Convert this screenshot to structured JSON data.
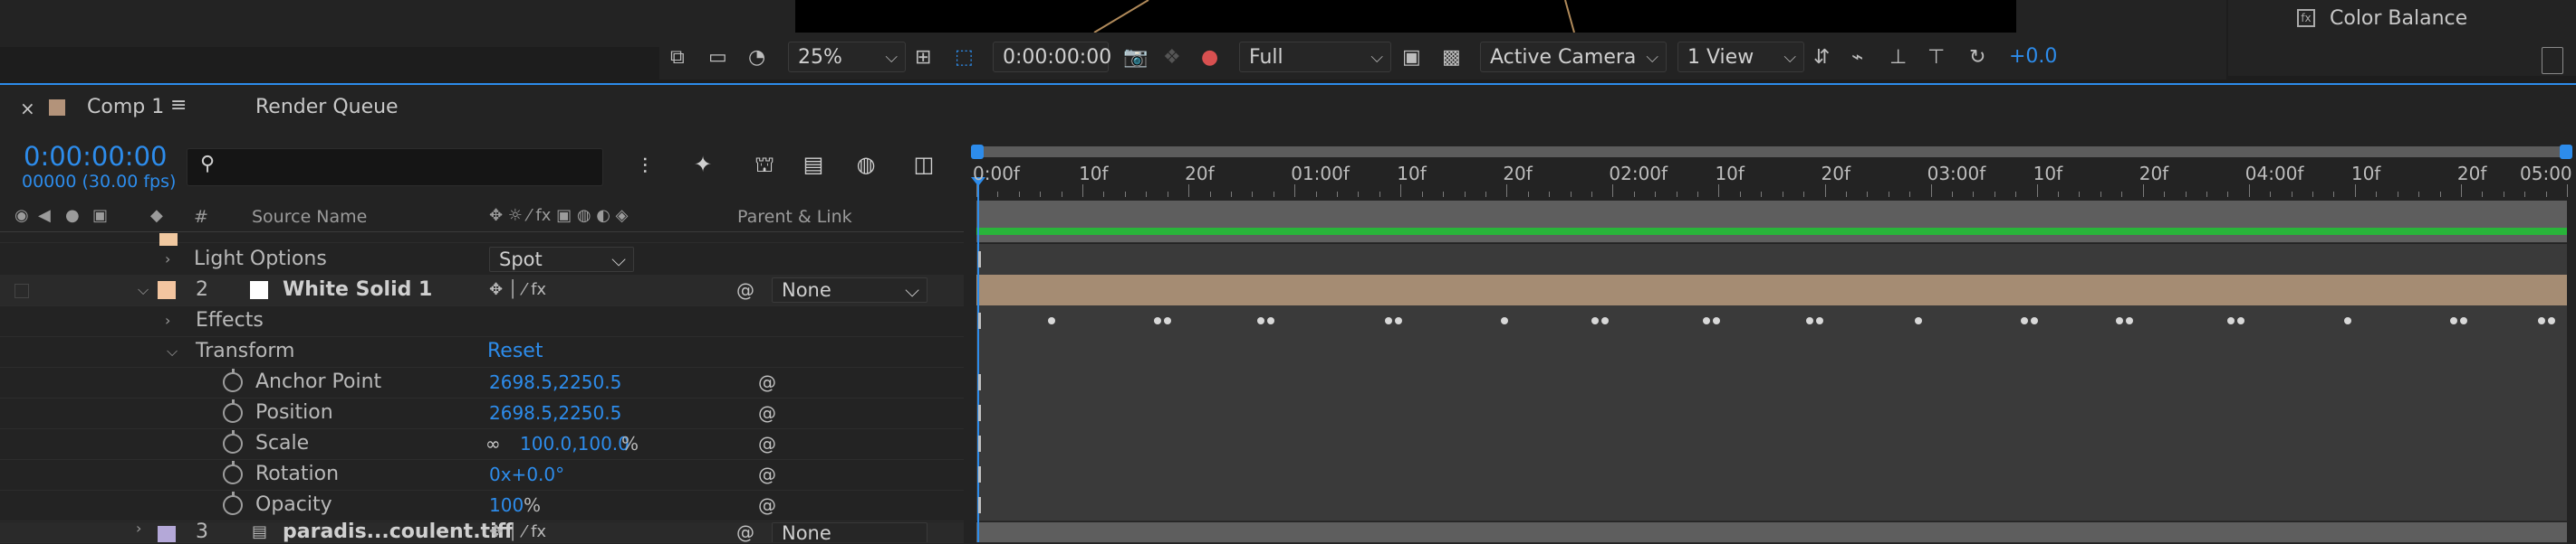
{
  "viewer": {
    "zoom": "25%",
    "timecode": "0:00:00:00",
    "resolution": "Full",
    "camera": "Active Camera",
    "views": "1 View",
    "exposure": "+0.0"
  },
  "right_panel": {
    "item_label": "Color Balance"
  },
  "tabs": [
    {
      "label": "Comp 1"
    },
    {
      "label": "Render Queue"
    }
  ],
  "timeline": {
    "current_time": "0:00:00:00",
    "frames": "00000 (30.00 fps)",
    "columns": {
      "hash": "#",
      "source_name": "Source Name",
      "parent_link": "Parent & Link"
    },
    "ruler_labels": [
      "0:00f",
      "10f",
      "20f",
      "01:00f",
      "10f",
      "20f",
      "02:00f",
      "10f",
      "20f",
      "03:00f",
      "10f",
      "20f",
      "04:00f",
      "10f",
      "20f",
      "05:00"
    ]
  },
  "layers": {
    "light_options": {
      "label": "Light Options",
      "value": "Spot"
    },
    "layer2": {
      "number": "2",
      "name": "White Solid 1",
      "parent": "None"
    },
    "effects": {
      "label": "Effects"
    },
    "transform": {
      "label": "Transform",
      "reset": "Reset"
    },
    "anchor_point": {
      "label": "Anchor Point",
      "value": "2698.5,2250.5"
    },
    "position": {
      "label": "Position",
      "value": "2698.5,2250.5"
    },
    "scale": {
      "label": "Scale",
      "value": "100.0,100.0",
      "unit": "%"
    },
    "rotation": {
      "label": "Rotation",
      "value": "0x+0.0°"
    },
    "opacity": {
      "label": "Opacity",
      "value": "100",
      "unit": "%"
    },
    "layer3": {
      "number": "3",
      "name": "paradis...coulent.tiff",
      "parent": "None"
    }
  },
  "colors": {
    "accent": "#2d8ceb",
    "light_label": "#f0c8a0",
    "solid_label": "#f3c5a0",
    "layer3_label": "#b4a8d8",
    "solid_bar": "#a58c73",
    "green_bar": "#29b43a"
  }
}
